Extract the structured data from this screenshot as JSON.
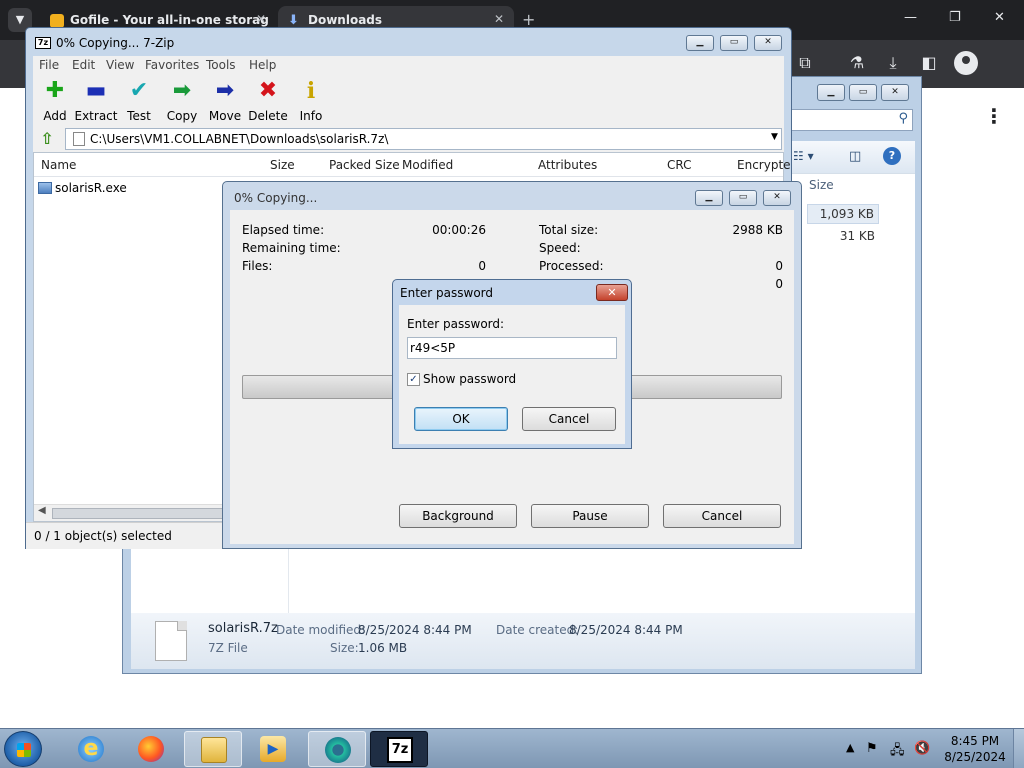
{
  "browser": {
    "tabs": [
      {
        "title": "Gofile - Your all-in-one storag"
      },
      {
        "title": "Downloads"
      }
    ]
  },
  "explorer": {
    "column_size": "Size",
    "sizes": [
      "1,093 KB",
      "31 KB"
    ],
    "details": {
      "file_name": "solarisR.7z",
      "file_type": "7Z File",
      "date_modified_label": "Date modified:",
      "date_modified": "8/25/2024 8:44 PM",
      "date_created_label": "Date created:",
      "date_created": "8/25/2024 8:44 PM",
      "size_label": "Size:",
      "size": "1.06 MB"
    }
  },
  "sevenzip": {
    "title": "0% Copying... 7-Zip",
    "app_icon": "7z",
    "menu": [
      "File",
      "Edit",
      "View",
      "Favorites",
      "Tools",
      "Help"
    ],
    "toolbar": [
      {
        "label": "Add",
        "icon": "plus-icon",
        "color": "#1aa51a"
      },
      {
        "label": "Extract",
        "icon": "minus-icon",
        "color": "#1c2fb5"
      },
      {
        "label": "Test",
        "icon": "check-icon",
        "color": "#18a7b0"
      },
      {
        "label": "Copy",
        "icon": "arrow-right-icon",
        "color": "#1a9a3a"
      },
      {
        "label": "Move",
        "icon": "arrow-right-icon",
        "color": "#1c2fa8"
      },
      {
        "label": "Delete",
        "icon": "x-icon",
        "color": "#d4141b"
      },
      {
        "label": "Info",
        "icon": "info-icon",
        "color": "#c9a400"
      }
    ],
    "path": "C:\\Users\\VM1.COLLABNET\\Downloads\\solarisR.7z\\",
    "columns": [
      "Name",
      "Size",
      "Packed Size",
      "Modified",
      "Attributes",
      "CRC",
      "Encrypte"
    ],
    "files": [
      {
        "name": "solarisR.exe"
      }
    ],
    "status": "0 / 1 object(s) selected"
  },
  "progress": {
    "title": "0% Copying...",
    "elapsed_label": "Elapsed time:",
    "elapsed_value": "00:00:26",
    "remaining_label": "Remaining time:",
    "files_label": "Files:",
    "files_value": "0",
    "total_size_label": "Total size:",
    "total_size_value": "2988 KB",
    "speed_label": "Speed:",
    "processed_label": "Processed:",
    "processed_value": "0",
    "extra_value": "0",
    "percent": 0,
    "buttons": {
      "background": "Background",
      "pause": "Pause",
      "cancel": "Cancel"
    }
  },
  "password_dialog": {
    "title": "Enter password",
    "label": "Enter password:",
    "value": "r49<5P",
    "show_password_label": "Show password",
    "show_password_checked": true,
    "ok": "OK",
    "cancel": "Cancel"
  },
  "taskbar": {
    "time": "8:45 PM",
    "date": "8/25/2024"
  }
}
